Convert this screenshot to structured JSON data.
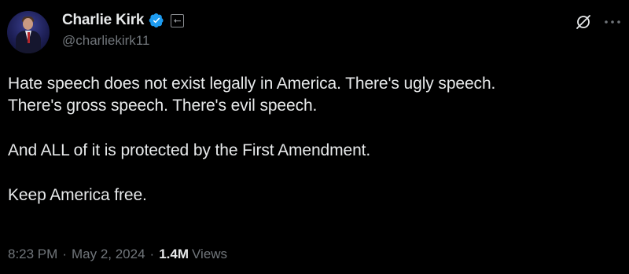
{
  "author": {
    "display_name": "Charlie Kirk",
    "handle": "@charliekirk11"
  },
  "tweet": {
    "lines": [
      "Hate speech does not exist legally in America. There's ugly speech.",
      "There's gross speech. There's evil speech.",
      "And ALL of it is protected by the First Amendment.",
      "Keep America free."
    ]
  },
  "meta": {
    "time": "8:23 PM",
    "separator": "·",
    "date": "May 2, 2024",
    "views_count": "1.4M",
    "views_label": "Views"
  },
  "icons": {
    "verified": "verified-badge-icon",
    "affiliate": "affiliate-badge-icon",
    "grok": "grok-icon",
    "more": "more-options-icon"
  },
  "colors": {
    "background": "#000000",
    "text_primary": "#e7e9ea",
    "text_secondary": "#71767b",
    "verified_blue": "#1d9bf0"
  }
}
